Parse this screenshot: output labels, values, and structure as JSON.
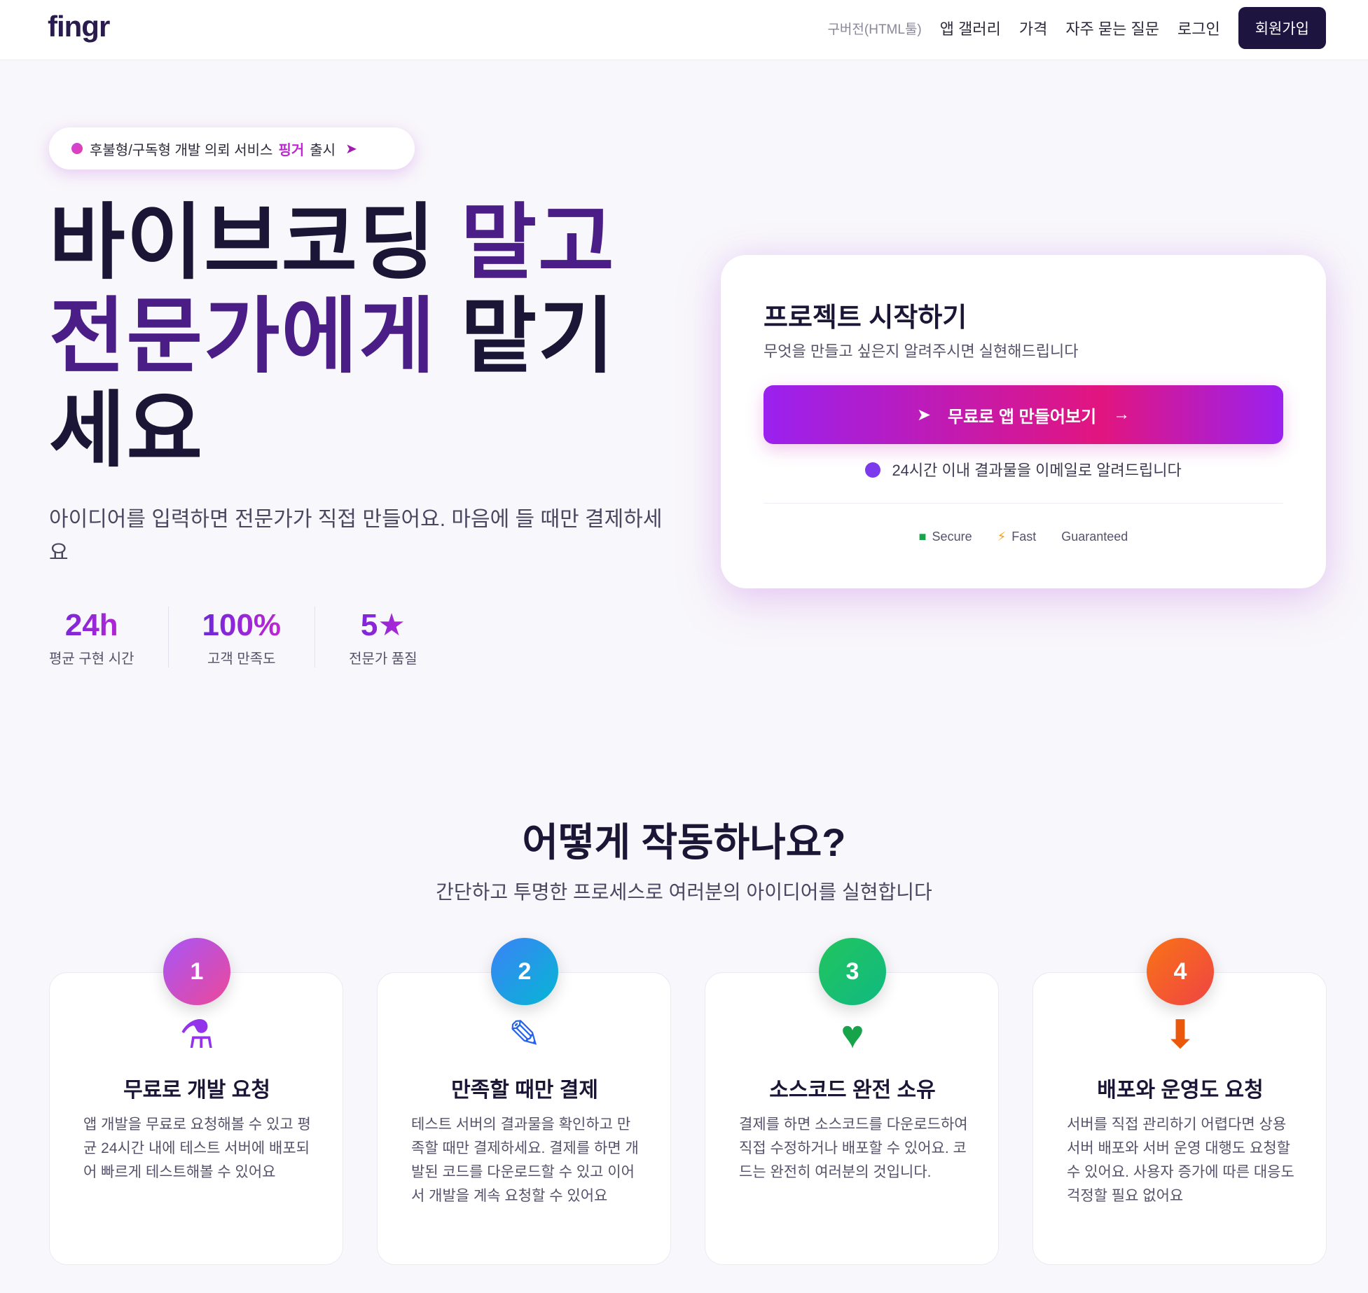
{
  "nav": {
    "logo": "fingr",
    "links": [
      "구버전(HTML툴)",
      "앱 갤러리",
      "가격",
      "자주 묻는 질문",
      "로그인"
    ],
    "signup": "회원가입"
  },
  "hero": {
    "badge": {
      "prefix": "후불형/구독형 개발 의뢰 서비스",
      "highlight": "핑거",
      "suffix": "출시",
      "icon": "rocket-icon"
    },
    "title_line1_a": "바이브코딩",
    "title_line1_b": "말고",
    "title_line2_a": "전문가에게",
    "title_line2_b": "맡기",
    "title_line3": "세요",
    "subtitle": "아이디어를 입력하면 전문가가 직접 만들어요. 마음에 들 때만 결제하세요",
    "stats": [
      {
        "value": "24h",
        "label": "평균 구현 시간"
      },
      {
        "value": "100%",
        "label": "고객 만족도"
      },
      {
        "value": "5★",
        "label": "전문가 품질"
      }
    ]
  },
  "card": {
    "title": "프로젝트 시작하기",
    "subtitle": "무엇을 만들고 싶은지 알려주시면 실현해드립니다",
    "cta": "무료로 앱 만들어보기",
    "cta_icon": "rocket-icon",
    "cta_arrow": "→",
    "notice": "24시간 이내 결과물을 이메일로 알려드립니다",
    "trust": [
      "Secure",
      "Fast",
      "Guaranteed"
    ]
  },
  "how": {
    "title": "어떻게 작동하나요?",
    "subtitle": "간단하고 투명한 프로세스로 여러분의 아이디어를 실현합니다",
    "steps": [
      {
        "num": "1",
        "icon": "flask-icon",
        "glyph": "⚗",
        "title": "무료로 개발 요청",
        "desc": "앱 개발을 무료로 요청해볼 수 있고 평균 24시간 내에 테스트 서버에 배포되어 빠르게 테스트해볼 수 있어요",
        "color": "#a855f7"
      },
      {
        "num": "2",
        "icon": "edit-icon",
        "glyph": "✎",
        "title": "만족할 때만 결제",
        "desc": "테스트 서버의 결과물을 확인하고 만족할 때만 결제하세요. 결제를 하면 개발된 코드를 다운로드할 수 있고 이어서 개발을 계속 요청할 수 있어요",
        "color": "#2563eb"
      },
      {
        "num": "3",
        "icon": "heart-icon",
        "glyph": "♥",
        "title": "소스코드 완전 소유",
        "desc": "결제를 하면 소스코드를 다운로드하여 직접 수정하거나 배포할 수 있어요. 코드는 완전히 여러분의 것입니다.",
        "color": "#16a34a"
      },
      {
        "num": "4",
        "icon": "download-icon",
        "glyph": "⬇",
        "title": "배포와 운영도 요청",
        "desc": "서버를 직접 관리하기 어렵다면 상용 서버 배포와 서버 운영 대행도 요청할 수 있어요. 사용자 증가에 따른 대응도 걱정할 필요 없어요",
        "color": "#ea580c"
      }
    ]
  }
}
